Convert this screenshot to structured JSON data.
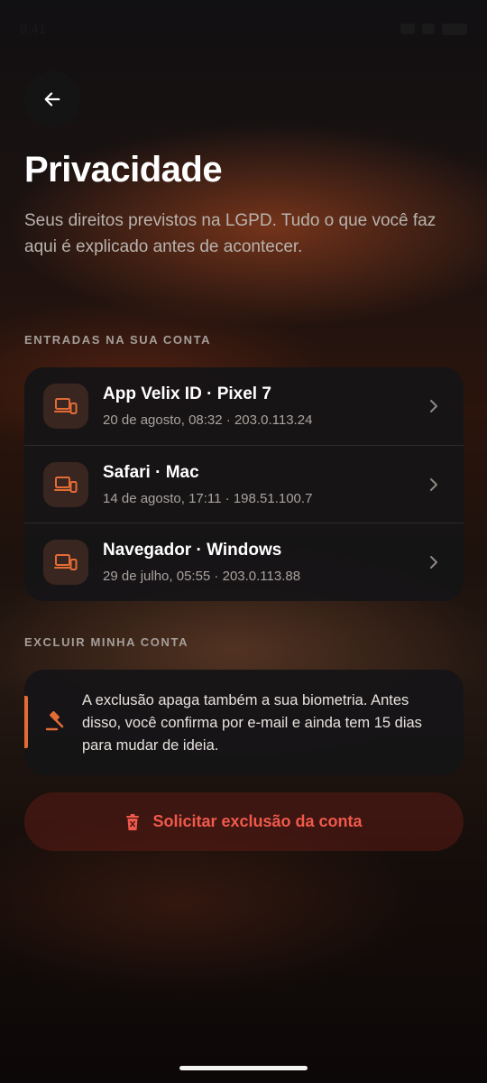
{
  "status_bar": {
    "time": "9:41"
  },
  "header": {
    "title": "Privacidade",
    "subtitle": "Seus direitos previstos na LGPD. Tudo o que você faz aqui é explicado antes de acontecer."
  },
  "sessions": {
    "section_label": "ENTRADAS NA SUA CONTA",
    "items": [
      {
        "name": "App Velix ID · Pixel 7",
        "meta": "20 de agosto, 08:32 · 203.0.113.24",
        "icon": "devices-icon"
      },
      {
        "name": "Safari · Mac",
        "meta": "14 de agosto, 17:11 · 198.51.100.7",
        "icon": "devices-icon"
      },
      {
        "name": "Navegador · Windows",
        "meta": "29 de julho, 05:55 · 203.0.113.88",
        "icon": "devices-icon"
      }
    ]
  },
  "delete_account": {
    "section_label": "EXCLUIR MINHA CONTA",
    "warning": "A exclusão apaga também a sua biometria. Antes disso, você confirma por e-mail e ainda tem 15 dias para mudar de ideia.",
    "button_label": "Solicitar exclusão da conta"
  },
  "colors": {
    "accent": "#e36c36",
    "danger": "#f0594b",
    "card": "#151416"
  }
}
